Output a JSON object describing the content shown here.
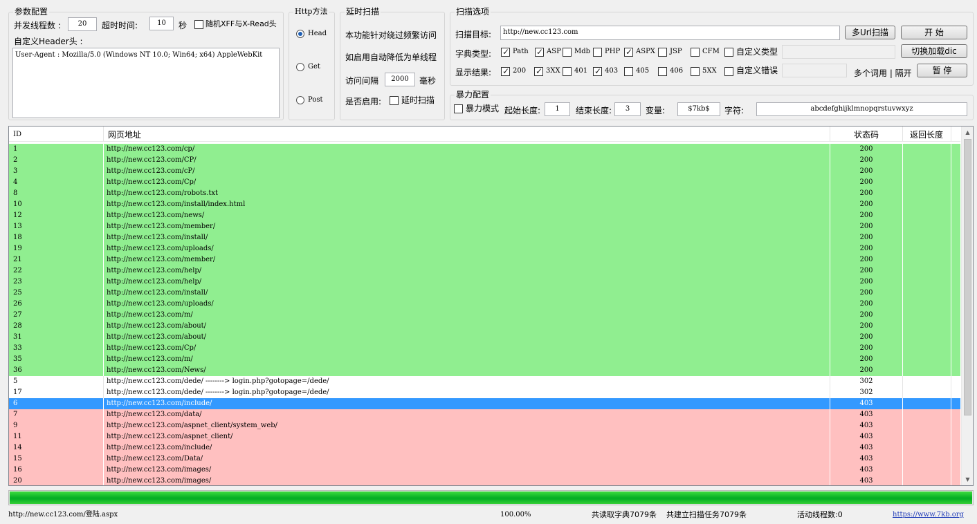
{
  "params": {
    "title": "参数配置",
    "threads_label": "并发线程数 :",
    "threads_value": "20",
    "timeout_label": "超时时间:",
    "timeout_value": "10",
    "timeout_unit": "秒",
    "random_xff_label": "随机XFF与X-Read头",
    "header_label": "自定义Header头 :",
    "header_value": "User-Agent : Mozilla/5.0 (Windows NT 10.0; Win64; x64) AppleWebKit"
  },
  "http": {
    "title": "Http方法",
    "options": [
      "Head",
      "Get",
      "Post"
    ]
  },
  "delay": {
    "title": "延时扫描",
    "desc1": "本功能针对绕过频繁访问",
    "desc2": "如启用自动降低为单线程",
    "interval_label": "访问间隔",
    "interval_value": "2000",
    "interval_unit": "毫秒",
    "enable_label": "是否启用:",
    "enable_checkbox": "延时扫描"
  },
  "scan": {
    "title": "扫描选项",
    "target_label": "扫描目标:",
    "target_value": "http://new.cc123.com",
    "multi_url_button": "多Url扫描",
    "start_button": "开 始",
    "dict_label": "字典类型:",
    "dict_types": [
      "Path",
      "ASP",
      "Mdb",
      "PHP",
      "ASPX",
      "JSP",
      "CFM"
    ],
    "custom_type_label": "自定义类型",
    "switch_dic_button": "切换加载dic",
    "result_label": "显示结果:",
    "result_codes": [
      "200",
      "3XX",
      "401",
      "403",
      "405",
      "406",
      "5XX"
    ],
    "custom_error_label": "自定义错误",
    "multi_word_note": "多个词用 | 隔开",
    "pause_button": "暂 停"
  },
  "brute": {
    "title": "暴力配置",
    "mode_label": "暴力模式",
    "start_len_label": "起始长度:",
    "start_len_value": "1",
    "end_len_label": "结束长度:",
    "end_len_value": "3",
    "var_label": "变量:",
    "var_value": "$7kb$",
    "charset_label": "字符:",
    "charset_value": "abcdefghijklmnopqrstuvwxyz"
  },
  "table": {
    "headers": [
      "ID",
      "网页地址",
      "状态码",
      "返回长度"
    ],
    "rows": [
      {
        "id": "1",
        "url": "http://new.cc123.com/cp/",
        "status": "200",
        "len": "",
        "style": "green"
      },
      {
        "id": "2",
        "url": "http://new.cc123.com/CP/",
        "status": "200",
        "len": "",
        "style": "green"
      },
      {
        "id": "3",
        "url": "http://new.cc123.com/cP/",
        "status": "200",
        "len": "",
        "style": "green"
      },
      {
        "id": "4",
        "url": "http://new.cc123.com/Cp/",
        "status": "200",
        "len": "",
        "style": "green"
      },
      {
        "id": "8",
        "url": "http://new.cc123.com/robots.txt",
        "status": "200",
        "len": "",
        "style": "green"
      },
      {
        "id": "10",
        "url": "http://new.cc123.com/install/index.html",
        "status": "200",
        "len": "",
        "style": "green"
      },
      {
        "id": "12",
        "url": "http://new.cc123.com/news/",
        "status": "200",
        "len": "",
        "style": "green"
      },
      {
        "id": "13",
        "url": "http://new.cc123.com/member/",
        "status": "200",
        "len": "",
        "style": "green"
      },
      {
        "id": "18",
        "url": "http://new.cc123.com/install/",
        "status": "200",
        "len": "",
        "style": "green"
      },
      {
        "id": "19",
        "url": "http://new.cc123.com/uploads/",
        "status": "200",
        "len": "",
        "style": "green"
      },
      {
        "id": "21",
        "url": "http://new.cc123.com/member/",
        "status": "200",
        "len": "",
        "style": "green"
      },
      {
        "id": "22",
        "url": "http://new.cc123.com/help/",
        "status": "200",
        "len": "",
        "style": "green"
      },
      {
        "id": "23",
        "url": "http://new.cc123.com/help/",
        "status": "200",
        "len": "",
        "style": "green"
      },
      {
        "id": "25",
        "url": "http://new.cc123.com/install/",
        "status": "200",
        "len": "",
        "style": "green"
      },
      {
        "id": "26",
        "url": "http://new.cc123.com/uploads/",
        "status": "200",
        "len": "",
        "style": "green"
      },
      {
        "id": "27",
        "url": "http://new.cc123.com/m/",
        "status": "200",
        "len": "",
        "style": "green"
      },
      {
        "id": "28",
        "url": "http://new.cc123.com/about/",
        "status": "200",
        "len": "",
        "style": "green"
      },
      {
        "id": "31",
        "url": "http://new.cc123.com/about/",
        "status": "200",
        "len": "",
        "style": "green"
      },
      {
        "id": "33",
        "url": "http://new.cc123.com/Cp/",
        "status": "200",
        "len": "",
        "style": "green"
      },
      {
        "id": "35",
        "url": "http://new.cc123.com/m/",
        "status": "200",
        "len": "",
        "style": "green"
      },
      {
        "id": "36",
        "url": "http://new.cc123.com/News/",
        "status": "200",
        "len": "",
        "style": "green"
      },
      {
        "id": "5",
        "url": "http://new.cc123.com/dede/  --------> login.php?gotopage=/dede/",
        "status": "302",
        "len": "",
        "style": "white"
      },
      {
        "id": "17",
        "url": "http://new.cc123.com/dede/  --------> login.php?gotopage=/dede/",
        "status": "302",
        "len": "",
        "style": "white"
      },
      {
        "id": "6",
        "url": "http://new.cc123.com/include/",
        "status": "403",
        "len": "",
        "style": "selected"
      },
      {
        "id": "7",
        "url": "http://new.cc123.com/data/",
        "status": "403",
        "len": "",
        "style": "red"
      },
      {
        "id": "9",
        "url": "http://new.cc123.com/aspnet_client/system_web/",
        "status": "403",
        "len": "",
        "style": "red"
      },
      {
        "id": "11",
        "url": "http://new.cc123.com/aspnet_client/",
        "status": "403",
        "len": "",
        "style": "red"
      },
      {
        "id": "14",
        "url": "http://new.cc123.com/include/",
        "status": "403",
        "len": "",
        "style": "red"
      },
      {
        "id": "15",
        "url": "http://new.cc123.com/Data/",
        "status": "403",
        "len": "",
        "style": "red"
      },
      {
        "id": "16",
        "url": "http://new.cc123.com/images/",
        "status": "403",
        "len": "",
        "style": "red"
      },
      {
        "id": "20",
        "url": "http://new.cc123.com/images/",
        "status": "403",
        "len": "",
        "style": "red"
      }
    ]
  },
  "progress": {
    "fraction": 1.0
  },
  "statusbar": {
    "current_url": "http://new.cc123.com/登陆.aspx",
    "percent": "100.00%",
    "dict_count": "共读取字典7079条",
    "task_count": "共建立扫描任务7079条",
    "active_threads": "活动线程数:0",
    "site_link": "https://www.7kb.org"
  },
  "colors": {
    "row_green": "#90ee90",
    "row_red": "#ffc0c0",
    "row_selected": "#3399ff",
    "progress": "#06b025"
  }
}
